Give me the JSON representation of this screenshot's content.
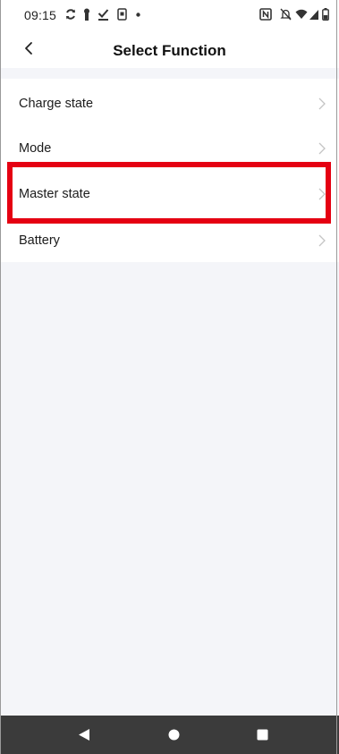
{
  "status_bar": {
    "time": "09:15"
  },
  "header": {
    "title": "Select Function",
    "back_icon": "chevron-left-icon"
  },
  "list": {
    "items": [
      {
        "label": "Charge state",
        "icon": "chevron-right-icon"
      },
      {
        "label": "Mode",
        "icon": "chevron-right-icon"
      },
      {
        "label": "Master state",
        "icon": "chevron-right-icon",
        "highlighted": true
      },
      {
        "label": "Battery",
        "icon": "chevron-right-icon"
      }
    ]
  },
  "nav_bar": {
    "buttons": [
      "back-triangle-icon",
      "home-circle-icon",
      "recents-square-icon"
    ]
  },
  "colors": {
    "background": "#f4f5f9",
    "highlight": "#e50012",
    "nav_bar": "#3b3b3b"
  }
}
